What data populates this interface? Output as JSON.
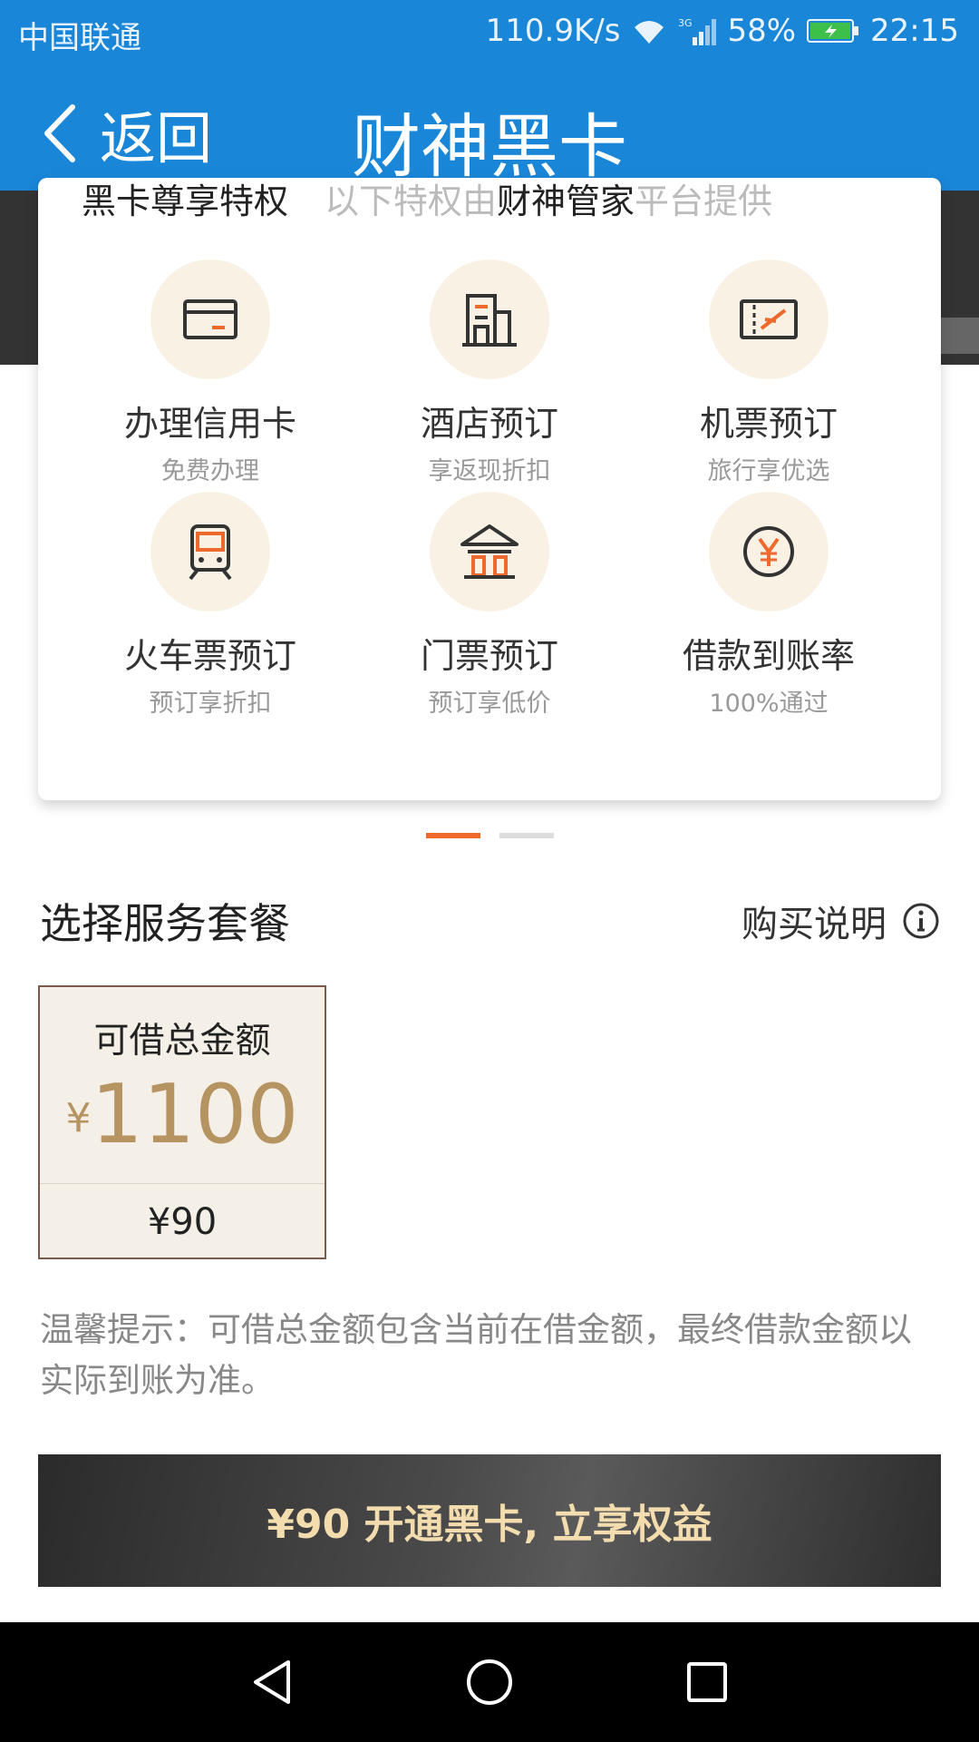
{
  "status_bar": {
    "carrier": "中国联通",
    "speed": "110.9K/s",
    "network": "3G",
    "battery": "58%",
    "time": "22:15"
  },
  "title_bar": {
    "back_label": "返回",
    "title": "财神黑卡"
  },
  "privilege_card": {
    "heading": "黑卡尊享特权",
    "subheading_prefix": "以下特权由",
    "subheading_platform": "财神管家",
    "subheading_suffix": "平台提供",
    "items": [
      {
        "label": "办理信用卡",
        "sub": "免费办理",
        "icon": "credit-card-icon"
      },
      {
        "label": "酒店预订",
        "sub": "享返现折扣",
        "icon": "hotel-icon"
      },
      {
        "label": "机票预订",
        "sub": "旅行享优选",
        "icon": "flight-ticket-icon"
      },
      {
        "label": "火车票预订",
        "sub": "预订享折扣",
        "icon": "train-icon"
      },
      {
        "label": "门票预订",
        "sub": "预订享低价",
        "icon": "attraction-ticket-icon"
      },
      {
        "label": "借款到账率",
        "sub": "100%通过",
        "icon": "yuan-icon"
      }
    ],
    "pages_total": 2,
    "page_active": 1
  },
  "service": {
    "section_title": "选择服务套餐",
    "buy_info_label": "购买说明",
    "package": {
      "caption": "可借总金额",
      "currency": "¥",
      "amount": "1100",
      "price": "¥90"
    },
    "tip": "温馨提示：可借总金额包含当前在借金额，最终借款金额以实际到账为准。"
  },
  "cta": {
    "label": "¥90 开通黑卡, 立享权益"
  },
  "colors": {
    "header_blue": "#1a86d8",
    "accent_orange": "#ee6a2c",
    "gold": "#b69462",
    "icon_bg": "#f8f1e4"
  }
}
